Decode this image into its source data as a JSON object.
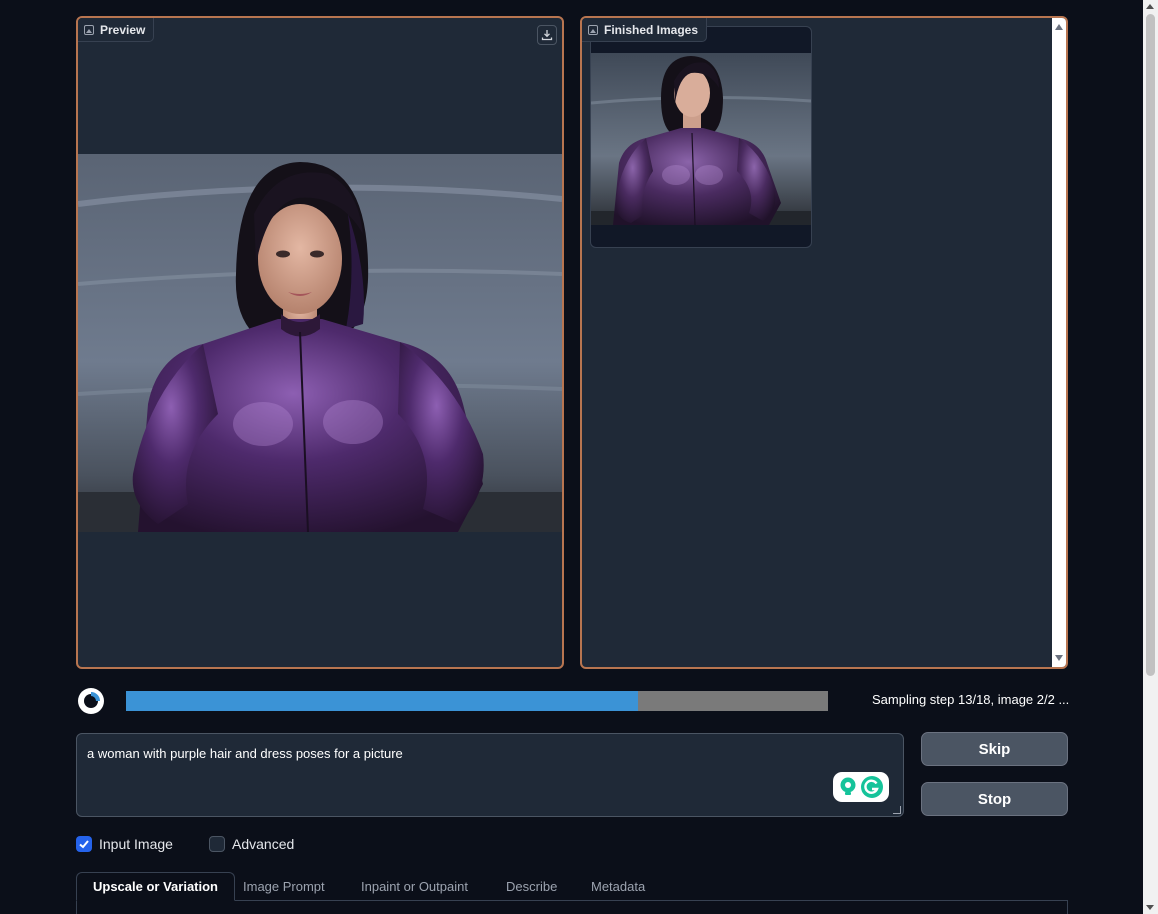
{
  "preview": {
    "label": "Preview",
    "download_icon": "download-icon"
  },
  "finished": {
    "label": "Finished Images"
  },
  "progress": {
    "percent": 73,
    "status_text": "Sampling step 13/18, image 2/2 ..."
  },
  "prompt": {
    "value": "a woman with purple hair and dress poses for a picture"
  },
  "buttons": {
    "skip": "Skip",
    "stop": "Stop"
  },
  "options": {
    "input_image_label": "Input Image",
    "input_image_checked": true,
    "advanced_label": "Advanced",
    "advanced_checked": false
  },
  "tabs": [
    {
      "label": "Upscale or Variation",
      "active": true
    },
    {
      "label": "Image Prompt",
      "active": false
    },
    {
      "label": "Inpaint or Outpaint",
      "active": false
    },
    {
      "label": "Describe",
      "active": false
    },
    {
      "label": "Metadata",
      "active": false
    }
  ],
  "colors": {
    "panel_border": "#b87550",
    "progress_fill": "#3b93d6",
    "progress_track": "#7a7a7a",
    "checkbox_on": "#2563eb"
  }
}
